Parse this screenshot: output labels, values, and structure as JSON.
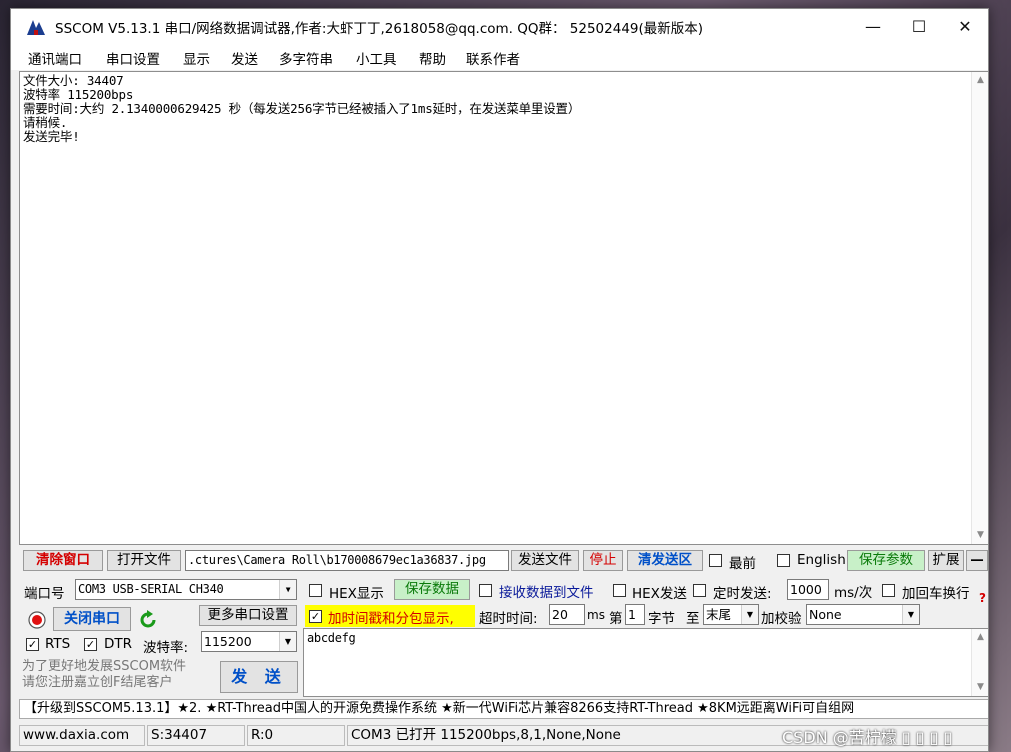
{
  "window": {
    "title": "SSCOM V5.13.1 串口/网络数据调试器,作者:大虾丁丁,2618058@qq.com. QQ群：  52502449(最新版本)",
    "minimize": "—",
    "maximize": "☐",
    "close": "✕"
  },
  "menu": [
    "通讯端口",
    "串口设置",
    "显示",
    "发送",
    "多字符串",
    "小工具",
    "帮助",
    "联系作者"
  ],
  "receive": {
    "text": "文件大小: 34407\n波特率 115200bps\n需要时间:大约 2.1340000629425 秒（每发送256字节已经被插入了1ms延时，在发送菜单里设置）\n请稍候.\n发送完毕!"
  },
  "toolbar": {
    "clear_window": "清除窗口",
    "open_file": "打开文件",
    "file_path": ".ctures\\Camera Roll\\b170008679ec1a36837.jpg",
    "send_file": "发送文件",
    "stop": "停止",
    "clear_send": "清发送区",
    "topmost": "最前",
    "english": "English",
    "save_params": "保存参数",
    "expand": "扩展",
    "collapse": "—"
  },
  "port": {
    "port_label": "端口号",
    "port_value": "COM3 USB-SERIAL CH340",
    "close_port": "关闭串口",
    "more_settings": "更多串口设置",
    "rts": "RTS",
    "dtr": "DTR",
    "baud_label": "波特率:",
    "baud_value": "115200"
  },
  "options": {
    "hex_display": "HEX显示",
    "save_data": "保存数据",
    "recv_to_file": "接收数据到文件",
    "hex_send": "HEX发送",
    "timed_send": "定时发送:",
    "interval": "1000",
    "interval_unit": "ms/次",
    "add_newline": "加回车换行",
    "timestamp": "加时间戳和分包显示,",
    "timeout_label": "超时时间:",
    "timeout_value": "20",
    "timeout_unit": "ms",
    "byte_prefix": "第",
    "byte_index": "1",
    "byte_label": "字节",
    "to_label": "至",
    "end_value": "末尾",
    "checksum_label": "加校验",
    "checksum_value": "None"
  },
  "send": {
    "text": "abcdefg",
    "send_button": "发 送"
  },
  "promo": {
    "line1": "为了更好地发展SSCOM软件",
    "line2": "请您注册嘉立创F结尾客户"
  },
  "ticker": "【升级到SSCOM5.13.1】★2. ★RT-Thread中国人的开源免费操作系统 ★新一代WiFi芯片兼容8266支持RT-Thread ★8KM远距离WiFi可自组网",
  "status": {
    "site": "www.daxia.com",
    "sent": "S:34407",
    "received": "R:0",
    "port_state": "COM3 已打开  115200bps,8,1,None,None"
  },
  "watermark": "CSDN @苦柠檬 ▯ ▯ ▯ ▯",
  "colors": {
    "accent_red": "#d40000",
    "accent_blue": "#0050c8",
    "highlight_yellow": "#ffff00"
  }
}
